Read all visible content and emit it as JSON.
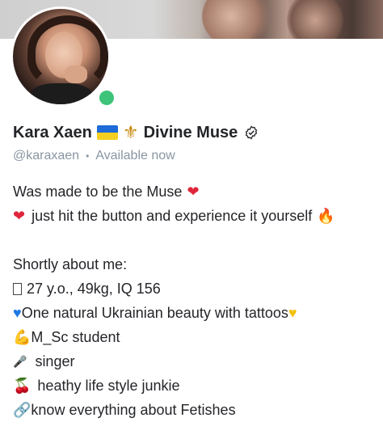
{
  "profile": {
    "name": "Kara Xaen",
    "title_suffix": "Divine Muse",
    "handle": "@karaxaen",
    "status": "Available now",
    "online_color": "#3ec37a",
    "icons": [
      "ukraine-flag-icon",
      "fleur-de-lis-icon",
      "verified-badge-icon"
    ]
  },
  "bio": {
    "line1": "Was made to be the Muse",
    "line2": "just hit the button and experience it yourself",
    "line3": "Shortly about me:",
    "line4": "27 y.o., 49kg, IQ 156",
    "line5": "One natural Ukrainian beauty with tattoos",
    "line6": "M_Sc student",
    "line7": "singer",
    "line8": "heathy life style junkie",
    "line9": "know everything about Fetishes"
  }
}
